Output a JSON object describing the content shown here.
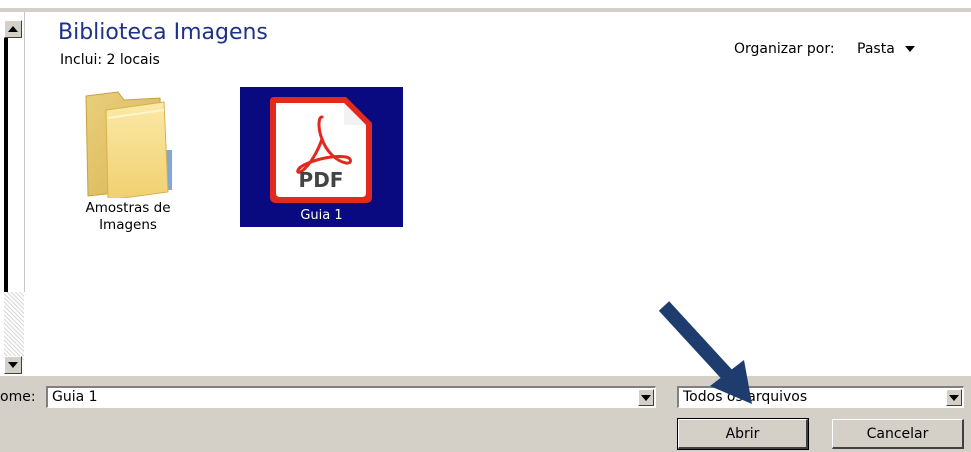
{
  "library": {
    "title": "Biblioteca Imagens",
    "subtitle": "Inclui:  2 locais"
  },
  "arrange": {
    "label": "Organizar por:",
    "value": "Pasta"
  },
  "items": [
    {
      "label_line1": "Amostras de",
      "label_line2": "Imagens",
      "icon": "folder-icon"
    },
    {
      "label": "Guia 1",
      "icon": "pdf-file-icon",
      "badge": "PDF",
      "selected": true
    }
  ],
  "footer": {
    "filename_label": "ome:",
    "filename_value": "Guia 1",
    "filter_value": "Todos os arquivos",
    "open_label": "Abrir",
    "cancel_label": "Cancelar"
  },
  "colors": {
    "selection": "#0a0a80",
    "title": "#1e3287",
    "pdf_red": "#e3281e",
    "arrow": "#1f3c6e",
    "dialog_gray": "#d4d0c8"
  }
}
